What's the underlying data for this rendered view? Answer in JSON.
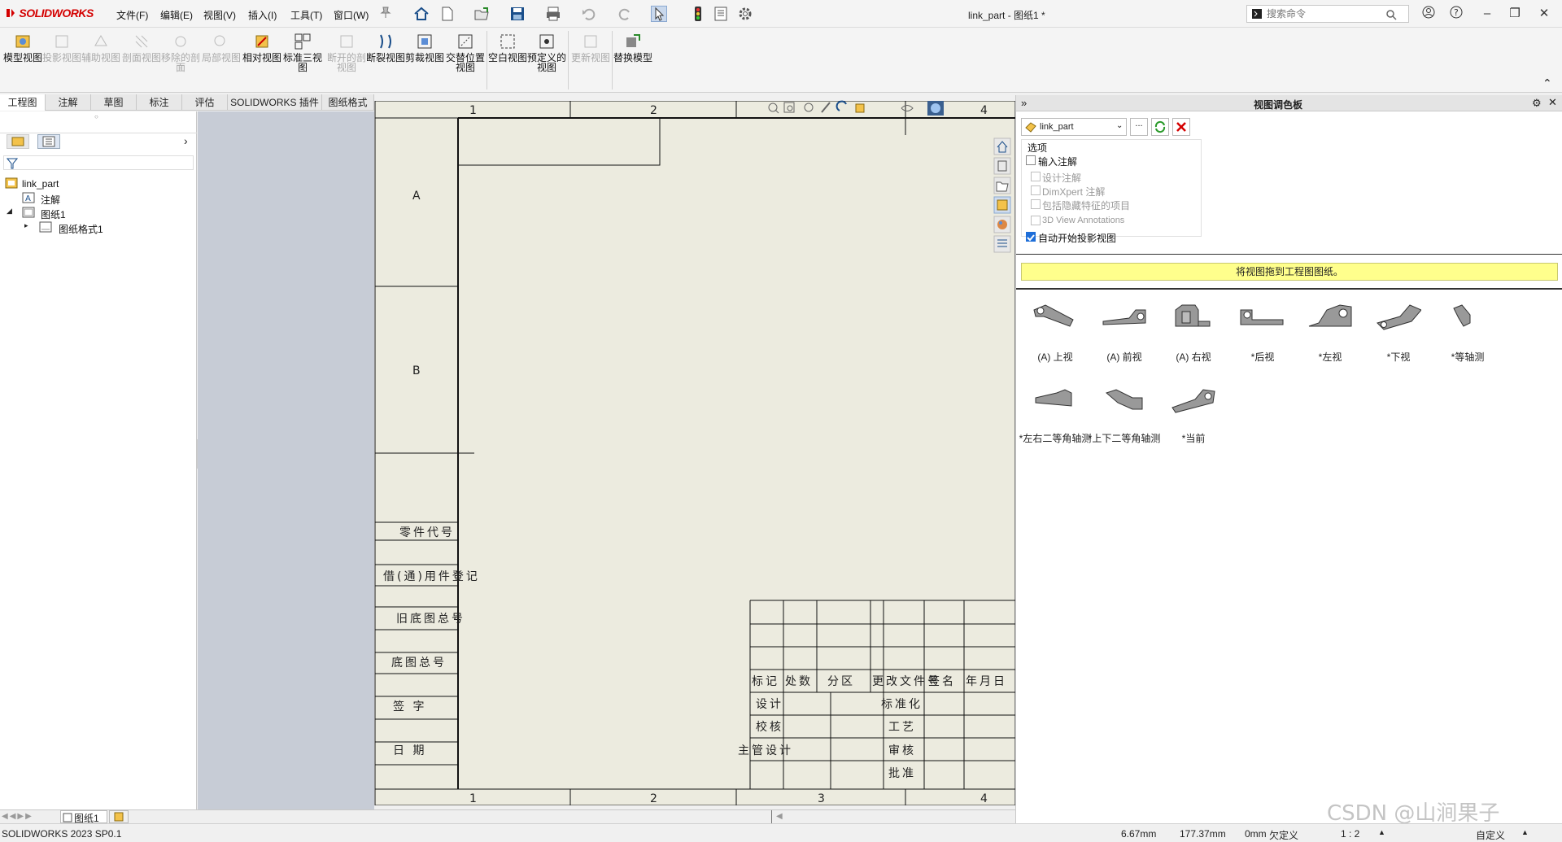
{
  "app": {
    "brand": "SOLIDWORKS",
    "title": "link_part - 图纸1 *"
  },
  "menu": [
    "文件(F)",
    "编辑(E)",
    "视图(V)",
    "插入(I)",
    "工具(T)",
    "窗口(W)"
  ],
  "search": {
    "placeholder": "搜索命令"
  },
  "commands": [
    {
      "label": "模型视图",
      "enabled": true
    },
    {
      "label": "投影视图",
      "enabled": false
    },
    {
      "label": "辅助视图",
      "enabled": false
    },
    {
      "label": "剖面视图",
      "enabled": false
    },
    {
      "label": "移除的剖面",
      "enabled": false
    },
    {
      "label": "局部视图",
      "enabled": false
    },
    {
      "label": "相对视图",
      "enabled": true
    },
    {
      "label": "标准三视图",
      "enabled": true
    },
    {
      "label": "断开的剖视图",
      "enabled": false
    },
    {
      "label": "断裂视图",
      "enabled": true
    },
    {
      "label": "剪裁视图",
      "enabled": true
    },
    {
      "label": "交替位置视图",
      "enabled": true
    },
    {
      "label": "空白视图",
      "enabled": true
    },
    {
      "label": "预定义的视图",
      "enabled": true
    },
    {
      "label": "更新视图",
      "enabled": false
    },
    {
      "label": "替换模型",
      "enabled": true
    }
  ],
  "tabs": [
    "工程图",
    "注解",
    "草图",
    "标注",
    "评估",
    "SOLIDWORKS 插件",
    "图纸格式"
  ],
  "tree": {
    "root": "link_part",
    "annotations": "注解",
    "sheet": "图纸1",
    "format": "图纸格式1"
  },
  "sheet": {
    "col_labels": [
      "1",
      "2",
      "3",
      "4"
    ],
    "row_labels": [
      "A",
      "B"
    ],
    "left_block": [
      "零件代号",
      "借(通)用件登记",
      "旧底图总号",
      "底图总号",
      "签  字",
      "日  期"
    ],
    "title_block": {
      "header": [
        "标记",
        "处数",
        "分区",
        "更改文件号",
        "签名",
        "年月日"
      ],
      "rows": [
        "设计",
        "校核",
        "主管设计"
      ],
      "right_rows": [
        "标准化",
        "工艺",
        "审核",
        "批准"
      ]
    }
  },
  "palette": {
    "title": "视图调色板",
    "model": "link_part",
    "options_title": "选项",
    "options": [
      {
        "label": "输入注解",
        "checked": false,
        "enabled": true
      },
      {
        "label": "设计注解",
        "checked": false,
        "enabled": false
      },
      {
        "label": "DimXpert 注解",
        "checked": false,
        "enabled": false
      },
      {
        "label": "包括隐藏特征的项目",
        "checked": false,
        "enabled": false
      },
      {
        "label": "3D View Annotations",
        "checked": false,
        "enabled": false
      },
      {
        "label": "自动开始投影视图",
        "checked": true,
        "enabled": true
      }
    ],
    "banner": "将视图拖到工程图图纸。",
    "views": [
      "(A) 上视",
      "(A) 前视",
      "(A) 右视",
      "*后视",
      "*左视",
      "*下视",
      "*等轴测",
      "*左右二等角轴测",
      "*上下二等角轴测",
      "*当前"
    ]
  },
  "sheet_tab": "图纸1",
  "status": {
    "version": "SOLIDWORKS 2023 SP0.1",
    "x": "6.67mm",
    "y": "177.37mm",
    "z": "0mm",
    "state": "欠定义",
    "scale": "1 : 2",
    "custom": "自定义",
    "watermark": "CSDN @山涧果子"
  },
  "colors": {
    "accent": "#d40000",
    "banner": "#ffff8c",
    "sheet": "#ecebdf",
    "canvas": "#c7ccd6"
  }
}
